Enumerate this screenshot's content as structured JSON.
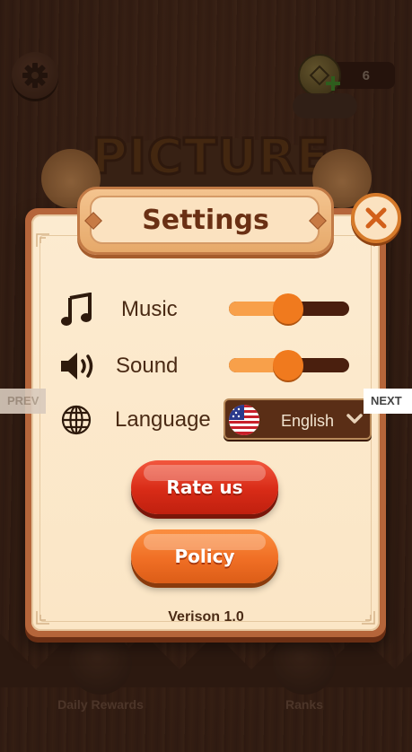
{
  "hud": {
    "coins": "6"
  },
  "background": {
    "game_title": "PICTURE",
    "bottom_nav": [
      {
        "label": "Daily Rewards"
      },
      {
        "label": "Ranks"
      }
    ]
  },
  "side_nav": {
    "prev": "PREV",
    "next": "NEXT"
  },
  "settings": {
    "title": "Settings",
    "rows": [
      {
        "label": "Music",
        "icon": "music-note-icon",
        "level": 0.49
      },
      {
        "label": "Sound",
        "icon": "speaker-icon",
        "level": 0.49
      },
      {
        "label": "Language",
        "icon": "globe-icon"
      }
    ],
    "language_value": "English",
    "language_flag": "us-flag-icon",
    "rate_label": "Rate us",
    "policy_label": "Policy",
    "version": "Verison 1.0"
  },
  "colors": {
    "panel": "#fbe6c6",
    "panel_border": "#b5653a",
    "slider_fill": "#f8a04a",
    "slider_track": "#4a1f0e",
    "knob": "#f07a1e",
    "rate_button": "#d82b17",
    "policy_button": "#f06f25",
    "close_ring": "#d67a2a"
  }
}
